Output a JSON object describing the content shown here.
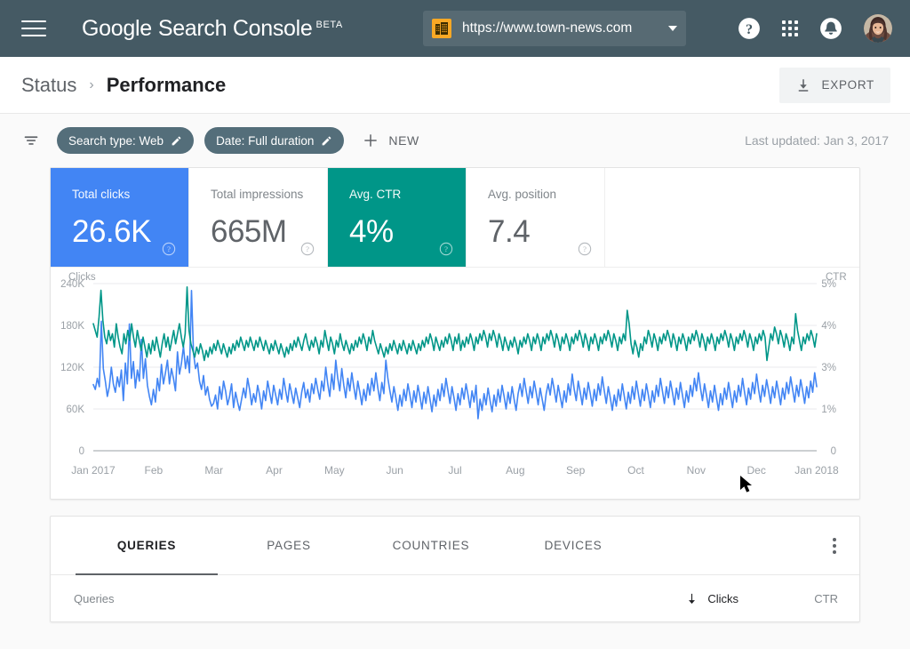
{
  "appbar": {
    "menu_icon": "hamburger-menu-icon",
    "brand_google": "Google",
    "brand_rest": "Search Console",
    "brand_badge": "BETA",
    "property": {
      "icon": "property-site-icon",
      "url": "https://www.town-news.com",
      "caret_icon": "chevron-down-icon"
    },
    "help_icon": "help-circle-icon",
    "apps_icon": "apps-grid-icon",
    "notifications_icon": "bell-icon",
    "avatar_icon": "user-avatar"
  },
  "page_header": {
    "breadcrumb_parent": "Status",
    "breadcrumb_separator": "›",
    "breadcrumb_current": "Performance",
    "export_label": "EXPORT",
    "export_icon": "download-icon"
  },
  "filter_bar": {
    "filter_icon": "filter-list-icon",
    "chips": [
      {
        "label": "Search type: Web",
        "edit_icon": "pencil-icon"
      },
      {
        "label": "Date: Full duration",
        "edit_icon": "pencil-icon"
      }
    ],
    "new_icon": "plus-icon",
    "new_label": "NEW",
    "last_updated": "Last updated: Jan 3, 2017"
  },
  "metrics": [
    {
      "label": "Total clicks",
      "value": "26.6K",
      "state": "selected-blue",
      "help_icon": "help-circle-icon"
    },
    {
      "label": "Total impressions",
      "value": "665M",
      "state": "inactive",
      "help_icon": "help-circle-icon"
    },
    {
      "label": "Avg. CTR",
      "value": "4%",
      "state": "selected-teal",
      "help_icon": "help-circle-icon"
    },
    {
      "label": "Avg. position",
      "value": "7.4",
      "state": "inactive",
      "help_icon": "help-circle-icon"
    }
  ],
  "colors": {
    "appbar_bg": "#455A64",
    "clicks_blue": "#4285F4",
    "ctr_teal": "#009688",
    "chip_bg": "#546E7A",
    "property_icon_orange": "#F9A825"
  },
  "tabs": [
    {
      "label": "QUERIES",
      "active": true
    },
    {
      "label": "PAGES",
      "active": false
    },
    {
      "label": "COUNTRIES",
      "active": false
    },
    {
      "label": "DEVICES",
      "active": false
    }
  ],
  "table": {
    "more_icon": "kebab-menu-icon",
    "columns": [
      "Queries",
      "Clicks",
      "CTR"
    ],
    "sort_column": "Clicks",
    "sort_icon": "arrow-down-icon",
    "rows": []
  },
  "chart_data": {
    "type": "line",
    "title": "",
    "xlabel": "",
    "ylabel": "Clicks",
    "y2label": "CTR",
    "grid": true,
    "legend": "none",
    "x_tick_labels": [
      "Jan 2017",
      "Feb",
      "Mar",
      "Apr",
      "May",
      "Jun",
      "Jul",
      "Aug",
      "Sep",
      "Oct",
      "Nov",
      "Dec",
      "Jan 2018"
    ],
    "y_tick_labels": [
      "0",
      "60K",
      "120K",
      "180K",
      "240K"
    ],
    "y_tick_values": [
      0,
      60000,
      120000,
      180000,
      240000
    ],
    "ylim": [
      0,
      240000
    ],
    "y2_tick_labels": [
      "0",
      "1%",
      "3%",
      "4%",
      "5%"
    ],
    "y2_tick_values": [
      0,
      2,
      3,
      4,
      5
    ],
    "y2lim": [
      0,
      5
    ],
    "series": [
      {
        "name": "Clicks",
        "color": "#4285F4",
        "axis": "left",
        "values": [
          95000,
          88000,
          104000,
          92000,
          186000,
          118000,
          100000,
          78000,
          92000,
          120000,
          96000,
          84000,
          106000,
          92000,
          116000,
          72000,
          126000,
          96000,
          182000,
          104000,
          128000,
          90000,
          116000,
          100000,
          160000,
          104000,
          132000,
          94000,
          78000,
          66000,
          88000,
          70000,
          104000,
          86000,
          124000,
          96000,
          112000,
          130000,
          96000,
          118000,
          104000,
          86000,
          142000,
          110000,
          126000,
          150000,
          118000,
          136000,
          112000,
          230000,
          140000,
          118000,
          126000,
          100000,
          88000,
          108000,
          80000,
          92000,
          74000,
          64000,
          68000,
          80000,
          60000,
          92000,
          74000,
          100000,
          86000,
          66000,
          78000,
          96000,
          62000,
          84000,
          70000,
          58000,
          74000,
          90000,
          76000,
          104000,
          88000,
          66000,
          82000,
          70000,
          94000,
          80000,
          60000,
          86000,
          72000,
          100000,
          84000,
          68000,
          94000,
          80000,
          66000,
          88000,
          74000,
          104000,
          86000,
          70000,
          96000,
          82000,
          68000,
          90000,
          76000,
          62000,
          84000,
          98000,
          76000,
          88000,
          70000,
          96000,
          82000,
          104000,
          88000,
          74000,
          100000,
          86000,
          120000,
          96000,
          78000,
          110000,
          88000,
          130000,
          104000,
          86000,
          118000,
          94000,
          76000,
          104000,
          86000,
          112000,
          92000,
          74000,
          100000,
          84000,
          66000,
          88000,
          72000,
          96000,
          80000,
          104000,
          86000,
          112000,
          90000,
          72000,
          98000,
          82000,
          130000,
          104000,
          86000,
          70000,
          92000,
          76000,
          58000,
          80000,
          64000,
          88000,
          72000,
          96000,
          80000,
          62000,
          86000,
          70000,
          94000,
          78000,
          60000,
          84000,
          68000,
          92000,
          74000,
          56000,
          80000,
          64000,
          88000,
          72000,
          96000,
          78000,
          104000,
          86000,
          68000,
          92000,
          76000,
          58000,
          82000,
          66000,
          90000,
          74000,
          96000,
          80000,
          62000,
          86000,
          70000,
          94000,
          46000,
          74000,
          58000,
          82000,
          66000,
          90000,
          72000,
          56000,
          80000,
          64000,
          88000,
          70000,
          94000,
          78000,
          60000,
          84000,
          68000,
          92000,
          74000,
          58000,
          82000,
          96000,
          78000,
          104000,
          86000,
          68000,
          92000,
          76000,
          100000,
          84000,
          66000,
          90000,
          74000,
          58000,
          82000,
          96000,
          80000,
          104000,
          88000,
          70000,
          94000,
          78000,
          62000,
          86000,
          70000,
          96000,
          80000,
          110000,
          88000,
          72000,
          100000,
          84000,
          66000,
          90000,
          74000,
          98000,
          82000,
          64000,
          88000,
          72000,
          96000,
          80000,
          106000,
          86000,
          68000,
          92000,
          76000,
          58000,
          80000,
          64000,
          88000,
          72000,
          96000,
          78000,
          60000,
          84000,
          68000,
          92000,
          74000,
          100000,
          82000,
          64000,
          88000,
          72000,
          96000,
          80000,
          62000,
          86000,
          70000,
          94000,
          78000,
          104000,
          86000,
          68000,
          92000,
          76000,
          100000,
          84000,
          66000,
          90000,
          74000,
          98000,
          80000,
          62000,
          86000,
          70000,
          94000,
          78000,
          104000,
          86000,
          112000,
          90000,
          72000,
          96000,
          80000,
          62000,
          86000,
          70000,
          94000,
          76000,
          58000,
          82000,
          66000,
          90000,
          74000,
          98000,
          80000,
          62000,
          86000,
          70000,
          94000,
          78000,
          104000,
          84000,
          66000,
          90000,
          74000,
          98000,
          82000,
          110000,
          88000,
          70000,
          94000,
          78000,
          102000,
          86000,
          68000,
          92000,
          76000,
          100000,
          84000,
          66000,
          90000,
          74000,
          98000,
          82000,
          106000,
          88000,
          70000,
          94000,
          78000,
          102000,
          86000,
          68000,
          92000,
          76000,
          100000,
          84000,
          112000,
          92000
        ]
      },
      {
        "name": "CTR",
        "color": "#009688",
        "axis": "right",
        "values": [
          3.8,
          3.6,
          3.4,
          4.0,
          4.8,
          3.9,
          3.4,
          3.2,
          3.6,
          3.3,
          3.5,
          3.1,
          3.8,
          3.4,
          3.1,
          2.9,
          3.5,
          3.2,
          3.6,
          3.3,
          3.8,
          3.4,
          3.1,
          3.6,
          3.3,
          3.0,
          3.4,
          3.1,
          2.8,
          3.2,
          2.9,
          3.3,
          3.0,
          3.4,
          3.1,
          2.8,
          3.2,
          3.5,
          3.1,
          3.4,
          3.0,
          3.3,
          3.6,
          3.2,
          3.5,
          3.8,
          3.4,
          3.1,
          3.5,
          4.9,
          3.6,
          3.2,
          3.0,
          2.8,
          3.1,
          2.9,
          3.2,
          3.0,
          2.7,
          3.0,
          2.8,
          3.1,
          2.9,
          3.2,
          3.0,
          3.3,
          3.1,
          2.9,
          3.2,
          3.0,
          2.8,
          3.1,
          2.9,
          3.2,
          3.0,
          3.3,
          3.1,
          3.4,
          3.2,
          3.0,
          3.3,
          3.1,
          3.4,
          3.2,
          3.0,
          3.3,
          3.1,
          3.4,
          3.2,
          3.0,
          3.3,
          3.1,
          2.9,
          3.2,
          3.0,
          3.3,
          3.1,
          2.9,
          3.2,
          3.0,
          2.8,
          3.1,
          2.9,
          3.2,
          3.0,
          3.3,
          3.1,
          3.4,
          3.2,
          3.0,
          3.3,
          3.5,
          3.2,
          3.0,
          3.3,
          3.1,
          3.4,
          3.2,
          2.9,
          3.3,
          3.1,
          3.6,
          3.3,
          3.0,
          3.4,
          3.2,
          2.9,
          3.3,
          3.1,
          3.5,
          3.2,
          3.0,
          3.3,
          3.1,
          2.9,
          3.2,
          3.0,
          3.3,
          3.1,
          3.4,
          3.2,
          3.5,
          3.3,
          3.0,
          3.4,
          3.2,
          3.6,
          3.3,
          3.1,
          2.9,
          3.2,
          3.0,
          2.8,
          3.1,
          2.9,
          3.2,
          3.0,
          3.3,
          3.1,
          2.9,
          3.2,
          3.0,
          3.3,
          3.1,
          2.9,
          3.2,
          3.0,
          3.3,
          3.1,
          2.9,
          3.2,
          3.0,
          3.3,
          3.1,
          3.4,
          3.2,
          3.5,
          3.3,
          3.0,
          3.4,
          3.2,
          3.0,
          3.3,
          3.1,
          3.4,
          3.2,
          3.5,
          3.3,
          3.0,
          3.4,
          3.2,
          3.5,
          3.0,
          3.3,
          3.1,
          3.4,
          3.2,
          3.5,
          3.3,
          3.0,
          3.4,
          3.2,
          3.5,
          3.3,
          3.6,
          3.4,
          3.1,
          3.5,
          3.3,
          3.6,
          3.4,
          3.1,
          3.5,
          3.3,
          3.0,
          3.4,
          3.2,
          3.0,
          3.3,
          3.1,
          3.4,
          3.2,
          2.9,
          3.3,
          3.1,
          3.4,
          3.2,
          3.5,
          3.3,
          3.0,
          3.4,
          3.2,
          3.5,
          3.3,
          3.0,
          3.4,
          3.2,
          3.5,
          3.3,
          3.6,
          3.4,
          3.1,
          3.5,
          3.3,
          3.0,
          3.4,
          3.2,
          3.5,
          3.3,
          3.0,
          3.4,
          3.2,
          3.5,
          3.3,
          3.6,
          3.4,
          3.1,
          3.5,
          3.3,
          3.0,
          3.4,
          3.2,
          3.5,
          3.3,
          3.0,
          3.4,
          3.2,
          3.5,
          3.3,
          3.6,
          3.4,
          3.1,
          3.5,
          3.3,
          3.0,
          3.4,
          3.2,
          3.5,
          3.3,
          4.2,
          3.8,
          3.2,
          2.9,
          3.3,
          3.1,
          2.8,
          3.2,
          3.0,
          3.4,
          3.2,
          3.6,
          3.4,
          3.1,
          3.5,
          3.3,
          3.0,
          3.4,
          3.2,
          3.5,
          3.3,
          3.6,
          3.4,
          3.1,
          3.5,
          3.3,
          3.0,
          3.4,
          3.2,
          3.5,
          3.3,
          3.0,
          3.4,
          3.2,
          3.5,
          3.3,
          3.6,
          3.4,
          3.1,
          3.5,
          3.3,
          3.0,
          3.4,
          3.2,
          3.5,
          3.3,
          3.0,
          3.4,
          3.2,
          3.5,
          3.3,
          3.6,
          3.4,
          3.1,
          3.5,
          3.3,
          3.0,
          3.4,
          3.2,
          3.5,
          3.3,
          3.6,
          3.4,
          3.1,
          3.5,
          3.3,
          3.0,
          3.4,
          3.2,
          3.5,
          3.3,
          3.6,
          3.4,
          2.7,
          3.1,
          3.5,
          3.3,
          3.7,
          3.5,
          3.2,
          3.6,
          3.4,
          3.1,
          3.5,
          3.3,
          3.0,
          3.4,
          3.2,
          4.1,
          3.6,
          3.3,
          3.0,
          3.4,
          3.2,
          3.5,
          3.3,
          3.6,
          3.4,
          3.1,
          3.5
        ]
      }
    ]
  }
}
